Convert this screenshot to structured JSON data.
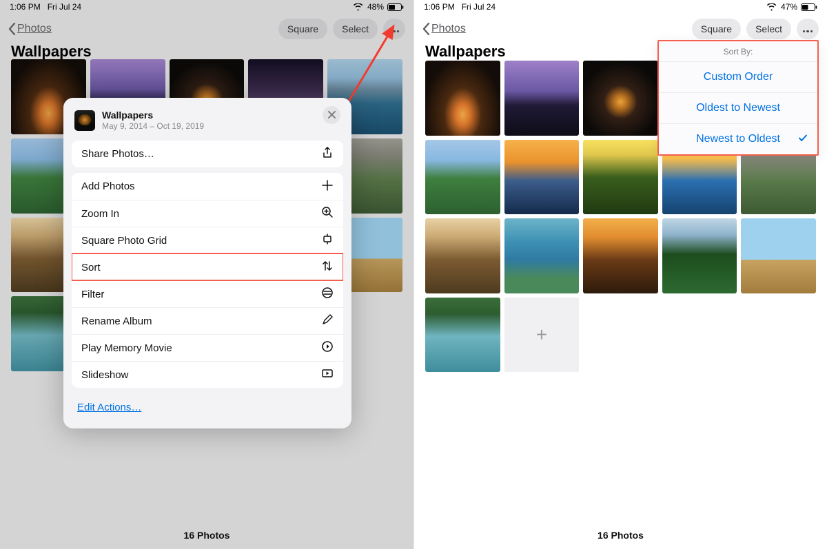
{
  "left": {
    "status": {
      "time": "1:06 PM",
      "date": "Fri Jul 24",
      "battery": "48%"
    },
    "nav": {
      "back": "Photos",
      "square": "Square",
      "select": "Select"
    },
    "title": "Wallpapers",
    "footer": "16 Photos",
    "sheet": {
      "title": "Wallpapers",
      "subtitle": "May 9, 2014 – Oct 19, 2019",
      "share": "Share Photos…",
      "add_photos": "Add Photos",
      "zoom_in": "Zoom In",
      "square_grid": "Square Photo Grid",
      "sort": "Sort",
      "filter": "Filter",
      "rename": "Rename Album",
      "memory": "Play Memory Movie",
      "slideshow": "Slideshow",
      "edit_actions": "Edit Actions…"
    }
  },
  "right": {
    "status": {
      "time": "1:06 PM",
      "date": "Fri Jul 24",
      "battery": "47%"
    },
    "nav": {
      "back": "Photos",
      "square": "Square",
      "select": "Select"
    },
    "title": "Wallpapers",
    "footer": "16 Photos",
    "sort_popover": {
      "caption": "Sort By:",
      "custom": "Custom Order",
      "oldest": "Oldest to Newest",
      "newest": "Newest to Oldest"
    }
  },
  "thumbs": {
    "t1": "radial-gradient(ellipse at 50% 72%, #eca545 0, #d5732a 14%, #4a2910 35%, #130c08 75%)",
    "t2": "linear-gradient(#9e80c8 0,#6b59a5 40%,#201a36 60%,#0d0c17 100%)",
    "t3": "radial-gradient(circle at 50% 55%, #e9a43a 0,#b56e1f 12%,#311f15 30%,#0c0a08 70%)",
    "t4": "linear-gradient(#130e22 0,#3c2b4e 40%,#5c476d 60%,#2f2640 100%)",
    "t5": "linear-gradient(#a8cae0 0,#8fb9d6 25%,#6b8ba0 40%,#2c6a8a 60%,#1a4e6e 100%)",
    "t6": "linear-gradient(#a4c8e8 0,#87b7df 28%,#3e7f3e 52%,#2d6030 100%)",
    "t7": "linear-gradient(#f7b24a 0,#e9922e 30%,#3c5d8b 55%,#142a4b 100%)",
    "t8": "linear-gradient(#f8e160 0,#e1c84d 20%,#3a5f1d 50%,#1f3a11 100%)",
    "t9": "linear-gradient(#ffe07a 0,#ffc24d 25%,#2b6fb1 55%,#15436f 100%)",
    "t10": "linear-gradient(#a0a098 0,#8a8a7f 20%,#5a7a4a 55%,#3d5a34 100%)",
    "t11": "linear-gradient(#e8d2a4 0,#caa872 25%,#7c5b32 55%,#4c3a1e 100%)",
    "t12": "linear-gradient(#6db4c9 0,#3f92b4 30%,#2f7aa3 55%,#4a8a5a 80%)",
    "t13": "linear-gradient(#f2b04a 0,#e28d2f 25%,#6b3b16 55%,#2d1a0b 100%)",
    "t14": "linear-gradient(#304a14 0,#6f8f21 25%,#d7b121 55%,#8f6b12 100%)",
    "t15": "linear-gradient(#c0d6e6 0,#8eb3cc 22%,#1c4c1e 48%,#2d6a30 100%)",
    "t16": "linear-gradient(180deg,#9ed1ee 0,#9ed1ee 55%,#c7a361 55%,#a17c3c 100%)",
    "t17": "linear-gradient(#3a6e3a 0,#2d5c30 22%,#6fb4bf 52%,#3f8d9d 100%)"
  }
}
